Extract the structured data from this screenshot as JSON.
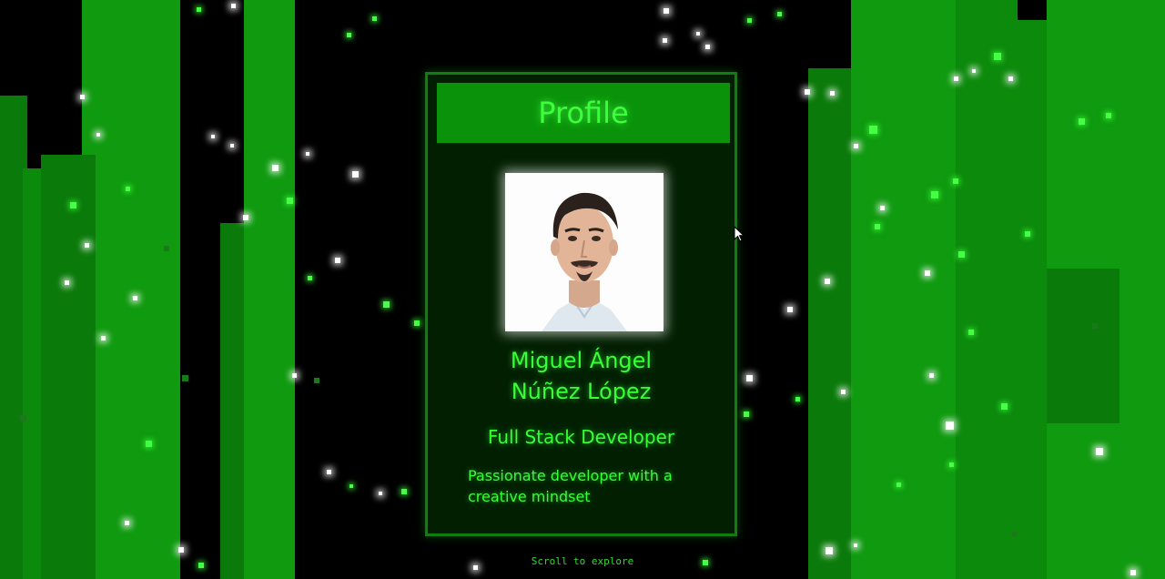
{
  "card": {
    "title": "Profile",
    "name_line1": "Miguel Ángel",
    "name_line2": "Núñez López",
    "role": "Full Stack Developer",
    "bio": "Passionate developer with a creative mindset"
  },
  "footer": {
    "scroll_hint": "Scroll to explore"
  },
  "theme": {
    "accent": "#36ff36",
    "pillar": "#0c8a0c",
    "card_background": "#021f02",
    "header_background": "#0a930a"
  },
  "icons": {
    "cursor": "mouse-pointer-icon",
    "avatar": "profile-photo"
  }
}
